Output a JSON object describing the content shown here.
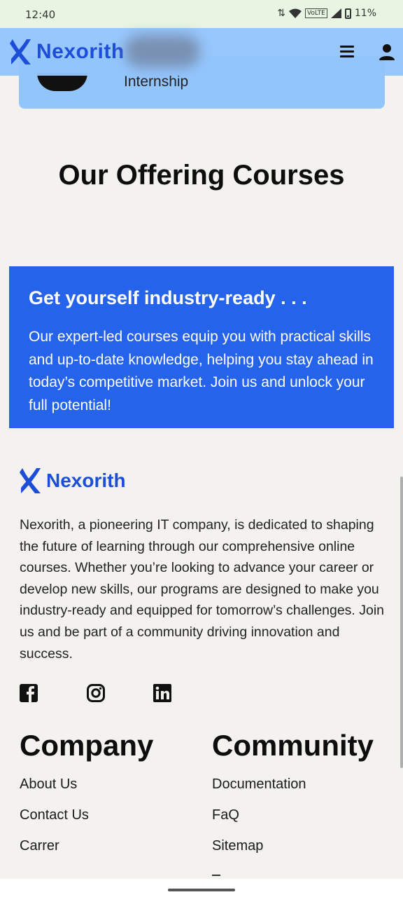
{
  "status_bar": {
    "time": "12:40",
    "network": "VoLTE",
    "battery": "11%"
  },
  "header": {
    "brand": "Nexorith"
  },
  "partial_card": {
    "label": "Internship"
  },
  "section": {
    "heading": "Our Offering Courses"
  },
  "banner": {
    "title": "Get yourself industry-ready . . .",
    "text": "Our expert-led courses equip you with practical skills and up-to-date knowledge, helping you stay ahead in today’s competitive market. Join us and unlock your full potential!"
  },
  "footer": {
    "brand": "Nexorith",
    "description": "Nexorith, a pioneering IT company, is dedicated to shaping the future of learning through our comprehensive online courses. Whether you’re looking to advance your career or develop new skills, our programs are designed to make you industry-ready and equipped for tomorrow’s challenges. Join us and be part of a community driving innovation and success.",
    "social": [
      "facebook-icon",
      "instagram-icon",
      "linkedin-icon"
    ],
    "company": {
      "title": "Company",
      "links": [
        "About Us",
        "Contact Us",
        "Carrer"
      ]
    },
    "community": {
      "title": "Community",
      "links": [
        "Documentation",
        "FaQ",
        "Sitemap"
      ]
    }
  },
  "colors": {
    "brand_blue": "#1d4ed8",
    "banner_blue": "#2563eb",
    "header_blue": "#93c5fd",
    "background": "#f3f2ef"
  }
}
